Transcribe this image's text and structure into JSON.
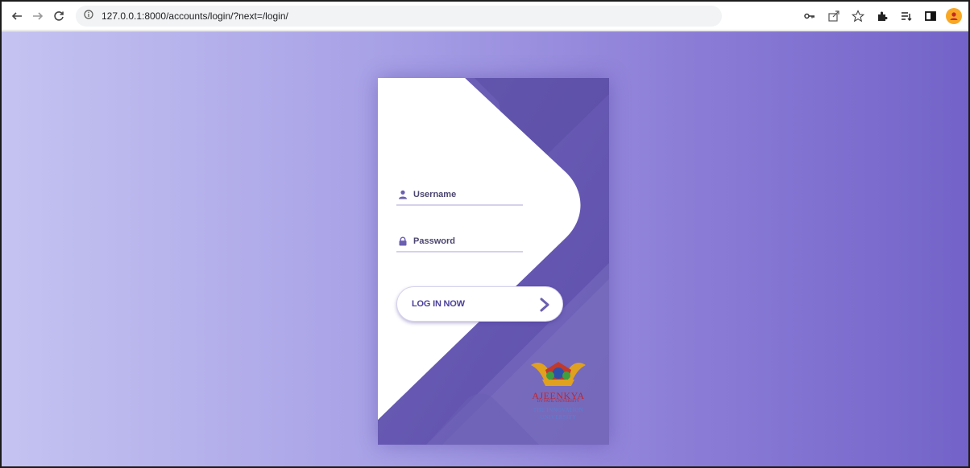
{
  "browser": {
    "url": "127.0.0.1:8000/accounts/login/?next=/login/",
    "icons": [
      "back-arrow-icon",
      "forward-arrow-icon",
      "reload-icon",
      "info-icon",
      "key-icon",
      "share-icon",
      "star-icon",
      "extensions-icon",
      "reading-list-icon",
      "side-panel-icon",
      "profile-icon"
    ]
  },
  "login": {
    "username_placeholder": "Username",
    "password_placeholder": "Password",
    "button_label": "LOG IN NOW"
  },
  "logo": {
    "title": "AJEENKYA",
    "subtitle": "DY PATIL UNIVERSITY",
    "tagline_1": "THE INNOVATION",
    "tagline_2": "UNIVERSITY"
  },
  "colors": {
    "page_gradient_start": "#c4c3f1",
    "page_gradient_end": "#7363c9",
    "card_purple": "#6b5cb5",
    "button_text": "#4a3f99"
  }
}
